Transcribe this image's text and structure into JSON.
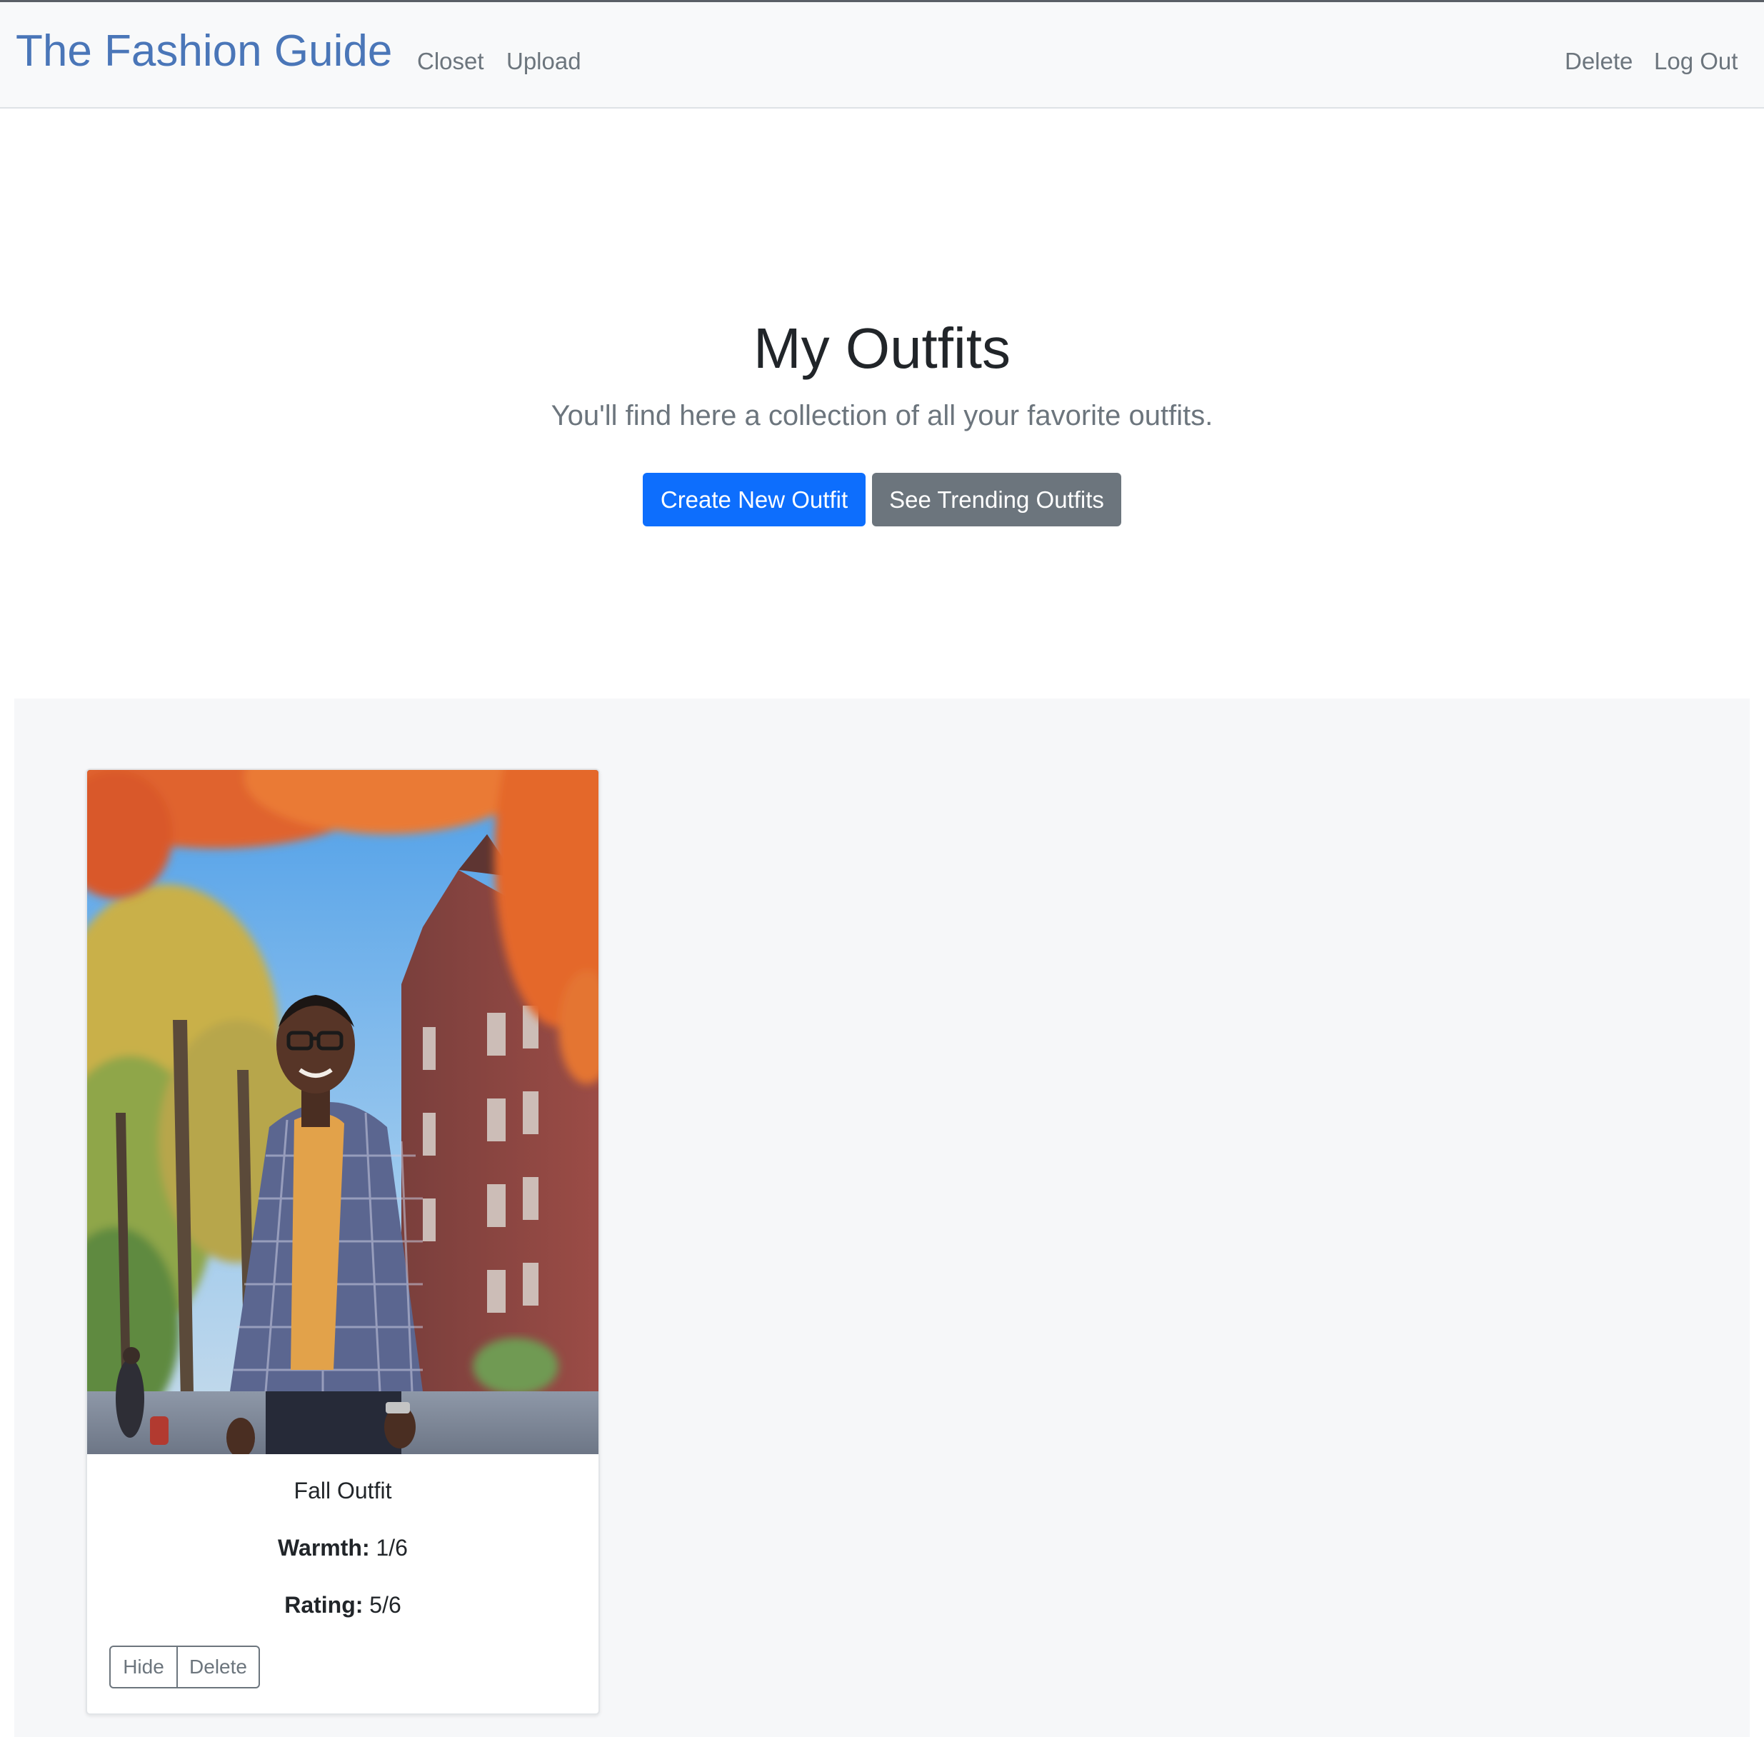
{
  "navbar": {
    "brand": "The Fashion Guide",
    "left_links": [
      "Closet",
      "Upload"
    ],
    "right_links": [
      "Delete",
      "Log Out"
    ]
  },
  "hero": {
    "title": "My Outfits",
    "subtitle": "You'll find here a collection of all your favorite outfits.",
    "primary_button": "Create New Outfit",
    "secondary_button": "See Trending Outfits"
  },
  "outfits": [
    {
      "name": "Fall Outfit",
      "warmth_label": "Warmth:",
      "warmth_value": "1/6",
      "rating_label": "Rating:",
      "rating_value": "5/6",
      "hide_label": "Hide",
      "delete_label": "Delete"
    }
  ],
  "colors": {
    "brand": "#4a76b8",
    "primary": "#0d6efd",
    "secondary": "#6c757d",
    "navbar_bg": "#f8f9fa",
    "album_bg": "#f6f7f9"
  }
}
